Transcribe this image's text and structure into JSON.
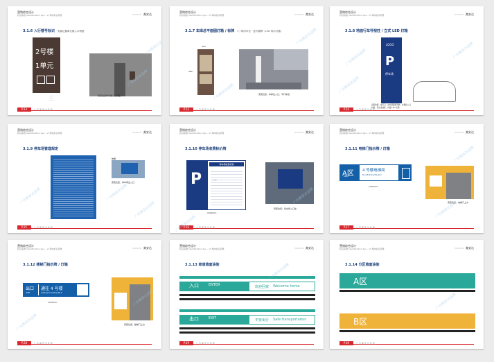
{
  "header": {
    "line1": "营销综合设计",
    "line2": "标识系统 Identification Sys...  VI 导向标识手册",
    "brand": "美安达",
    "brand_small": "HANSON"
  },
  "footer_text": "广 东 美 安 达 集 团",
  "pages": [
    {
      "num": "P.23",
      "title": "3.1.6  入行楼号标识",
      "subtitle": "安装位置单元楼入口侧面",
      "sign": {
        "line1": "2号楼",
        "line2": "1单元"
      },
      "caption": "安装位置单元楼入口侧面"
    },
    {
      "num": "P.23",
      "title": "3.1.7  车库总平面图灯箱 / 标牌",
      "subtitle": "3 / 场内车位 · 室外铺牌（LED 导示灯箱）",
      "dims": {
        "w": "400",
        "h": "400"
      },
      "caption": "安装位置：车库出入口，平行车道"
    },
    {
      "num": "P.24",
      "title": "3.1.8  地面行车导视柱 / 立式 LED 灯箱",
      "sign": {
        "logo": "LOGO",
        "letter": "P",
        "text": "停车场"
      },
      "caption": "安装位置：车库口，前方道路转弯处，车辆出入口",
      "note": "材料：铝合金边框，内置 LED 光源"
    },
    {
      "num": "P.25",
      "title": "3.1.9  停车场管理规定",
      "side_label": "效果：",
      "caption": "安装位置：停车场出入口"
    },
    {
      "num": "P.26",
      "title": "3.1.10  停车场收费标价牌",
      "sign": {
        "letter": "P",
        "header": "停车场收费标准",
        "label": "小车"
      },
      "caption": "安装位置：停车场入口处",
      "dim": "1600mm"
    },
    {
      "num": "P.27",
      "title": "3.1.11  电梯门指示牌 / 灯箱",
      "sign": {
        "zone": "A区",
        "zone_sub": "AREA",
        "text": "4 号楼电梯间",
        "text_en": "No.4 Building Elevator"
      },
      "dim": "1200mm",
      "caption": "安装位置：电梯门上方"
    },
    {
      "num": "P.28",
      "title": "3.1.12  楼梯门指示牌 / 灯箱",
      "sign": {
        "label": "出口",
        "label_en": "EXIT",
        "text": "通往 4 号楼",
        "text_en": "Leading to building No.4"
      },
      "dim": "1200mm",
      "caption": "安装位置：楼梯门上方"
    },
    {
      "num": "P.29",
      "title": "3.1.13  坡道墙面涂装",
      "enter": {
        "label": "入口",
        "en": "ENTER",
        "welcome": "欢迎回家",
        "welcome_en": "Welcome home"
      },
      "exit": {
        "label": "出口",
        "en": "EXIT",
        "safe": "平安出行",
        "safe_en": "Safe transportation"
      }
    },
    {
      "num": "P.30",
      "title": "3.1.14  分区墙面涂装",
      "zone_a": "A区",
      "zone_b": "B区"
    }
  ],
  "watermark": "广州美安达品牌",
  "colors": {
    "navy": "#1a3a82",
    "teal": "#2aa89a",
    "blue": "#1460a8",
    "yellow": "#f0b33a",
    "red": "#d9272e",
    "bronze": "#4b3a33"
  }
}
